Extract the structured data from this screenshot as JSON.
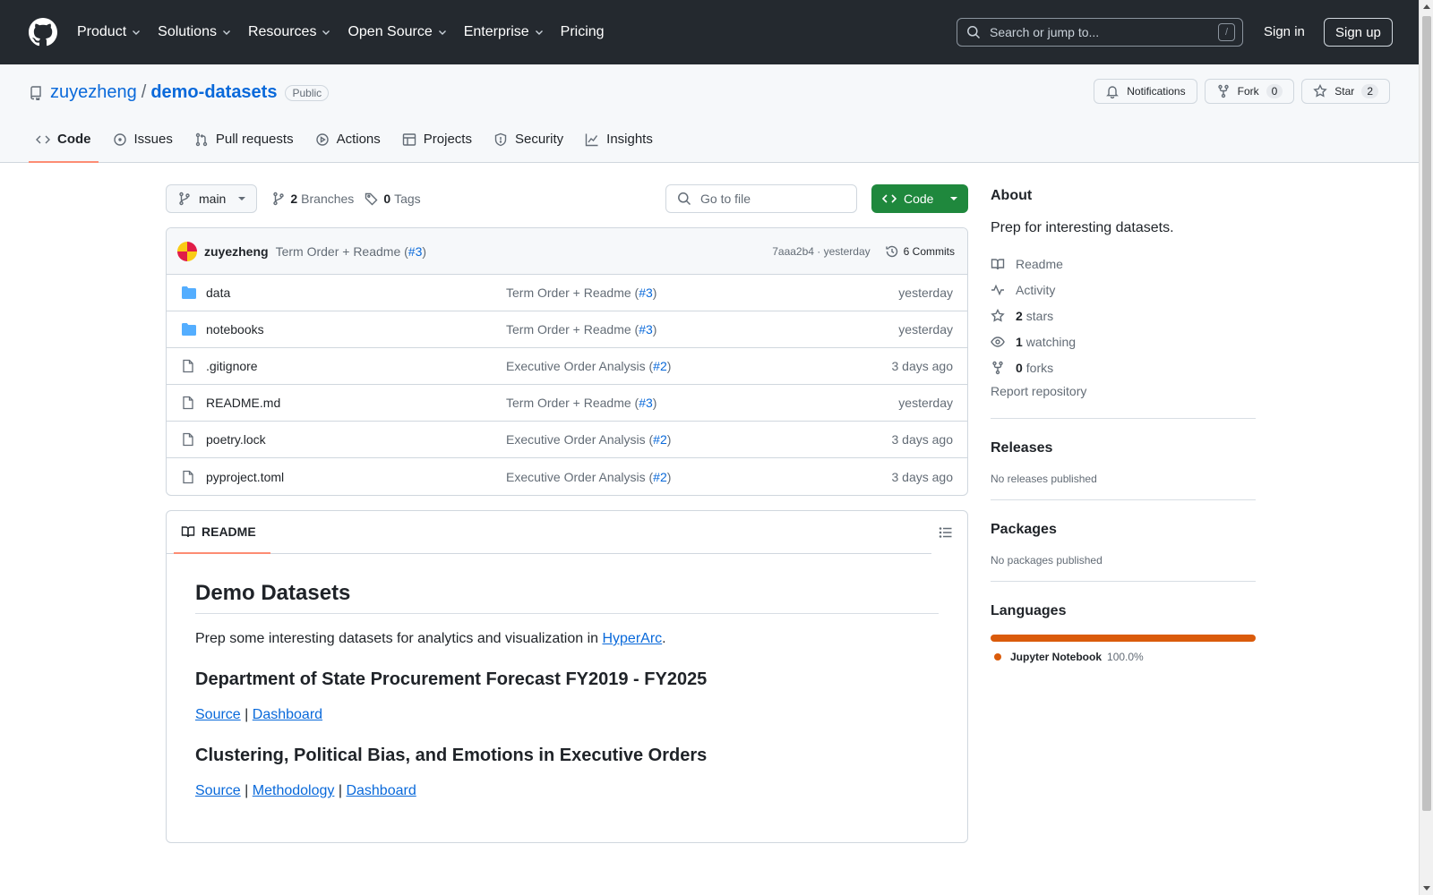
{
  "header": {
    "nav": [
      {
        "label": "Product",
        "has_menu": true
      },
      {
        "label": "Solutions",
        "has_menu": true
      },
      {
        "label": "Resources",
        "has_menu": true
      },
      {
        "label": "Open Source",
        "has_menu": true
      },
      {
        "label": "Enterprise",
        "has_menu": true
      },
      {
        "label": "Pricing",
        "has_menu": false
      }
    ],
    "search_placeholder": "Search or jump to...",
    "search_shortcut": "/",
    "sign_in": "Sign in",
    "sign_up": "Sign up"
  },
  "repo": {
    "owner": "zuyezheng",
    "separator": "/",
    "name": "demo-datasets",
    "visibility": "Public",
    "actions": {
      "notifications": "Notifications",
      "fork": "Fork",
      "fork_count": "0",
      "star": "Star",
      "star_count": "2"
    },
    "tabs": [
      {
        "label": "Code",
        "icon": "code-icon",
        "active": true
      },
      {
        "label": "Issues",
        "icon": "issue-icon",
        "active": false
      },
      {
        "label": "Pull requests",
        "icon": "pull-request-icon",
        "active": false
      },
      {
        "label": "Actions",
        "icon": "play-icon",
        "active": false
      },
      {
        "label": "Projects",
        "icon": "table-icon",
        "active": false
      },
      {
        "label": "Security",
        "icon": "shield-icon",
        "active": false
      },
      {
        "label": "Insights",
        "icon": "graph-icon",
        "active": false
      }
    ]
  },
  "toolbar": {
    "branch": "main",
    "branches_count": "2",
    "branches_label": "Branches",
    "tags_count": "0",
    "tags_label": "Tags",
    "goto_placeholder": "Go to file",
    "code_button": "Code"
  },
  "latest_commit": {
    "user": "zuyezheng",
    "message": "Term Order + Readme (",
    "pr": "#3",
    "message_end": ")",
    "hash": "7aaa2b4",
    "dot": "·",
    "when": "yesterday",
    "commits_label": "6 Commits"
  },
  "files": [
    {
      "type": "folder",
      "name": "data",
      "msg": "Term Order + Readme (",
      "pr": "#3",
      "msg_end": ")",
      "date": "yesterday"
    },
    {
      "type": "folder",
      "name": "notebooks",
      "msg": "Term Order + Readme (",
      "pr": "#3",
      "msg_end": ")",
      "date": "yesterday"
    },
    {
      "type": "file",
      "name": ".gitignore",
      "msg": "Executive Order Analysis (",
      "pr": "#2",
      "msg_end": ")",
      "date": "3 days ago"
    },
    {
      "type": "file",
      "name": "README.md",
      "msg": "Term Order + Readme (",
      "pr": "#3",
      "msg_end": ")",
      "date": "yesterday"
    },
    {
      "type": "file",
      "name": "poetry.lock",
      "msg": "Executive Order Analysis (",
      "pr": "#2",
      "msg_end": ")",
      "date": "3 days ago"
    },
    {
      "type": "file",
      "name": "pyproject.toml",
      "msg": "Executive Order Analysis (",
      "pr": "#2",
      "msg_end": ")",
      "date": "3 days ago"
    }
  ],
  "readme": {
    "tab_label": "README",
    "title": "Demo Datasets",
    "intro_pre": "Prep some interesting datasets for analytics and visualization in ",
    "intro_link": "HyperArc",
    "intro_post": ".",
    "section1_title": "Department of State Procurement Forecast FY2019 - FY2025",
    "section1_links": [
      "Source",
      "Dashboard"
    ],
    "section2_title": "Clustering, Political Bias, and Emotions in Executive Orders",
    "section2_links": [
      "Source",
      "Methodology",
      "Dashboard"
    ],
    "link_sep": "|"
  },
  "sidebar": {
    "about_title": "About",
    "description": "Prep for interesting datasets.",
    "links": [
      {
        "icon": "book-icon",
        "count": "",
        "label": "Readme"
      },
      {
        "icon": "pulse-icon",
        "count": "",
        "label": "Activity"
      },
      {
        "icon": "star-icon",
        "count": "2",
        "label": "stars"
      },
      {
        "icon": "eye-icon",
        "count": "1",
        "label": "watching"
      },
      {
        "icon": "fork-icon",
        "count": "0",
        "label": "forks"
      }
    ],
    "report": "Report repository",
    "releases_title": "Releases",
    "releases_text": "No releases published",
    "packages_title": "Packages",
    "packages_text": "No packages published",
    "languages_title": "Languages",
    "languages": [
      {
        "name": "Jupyter Notebook",
        "percent": "100.0%",
        "color": "#da5b0b",
        "share": 1.0
      }
    ]
  }
}
